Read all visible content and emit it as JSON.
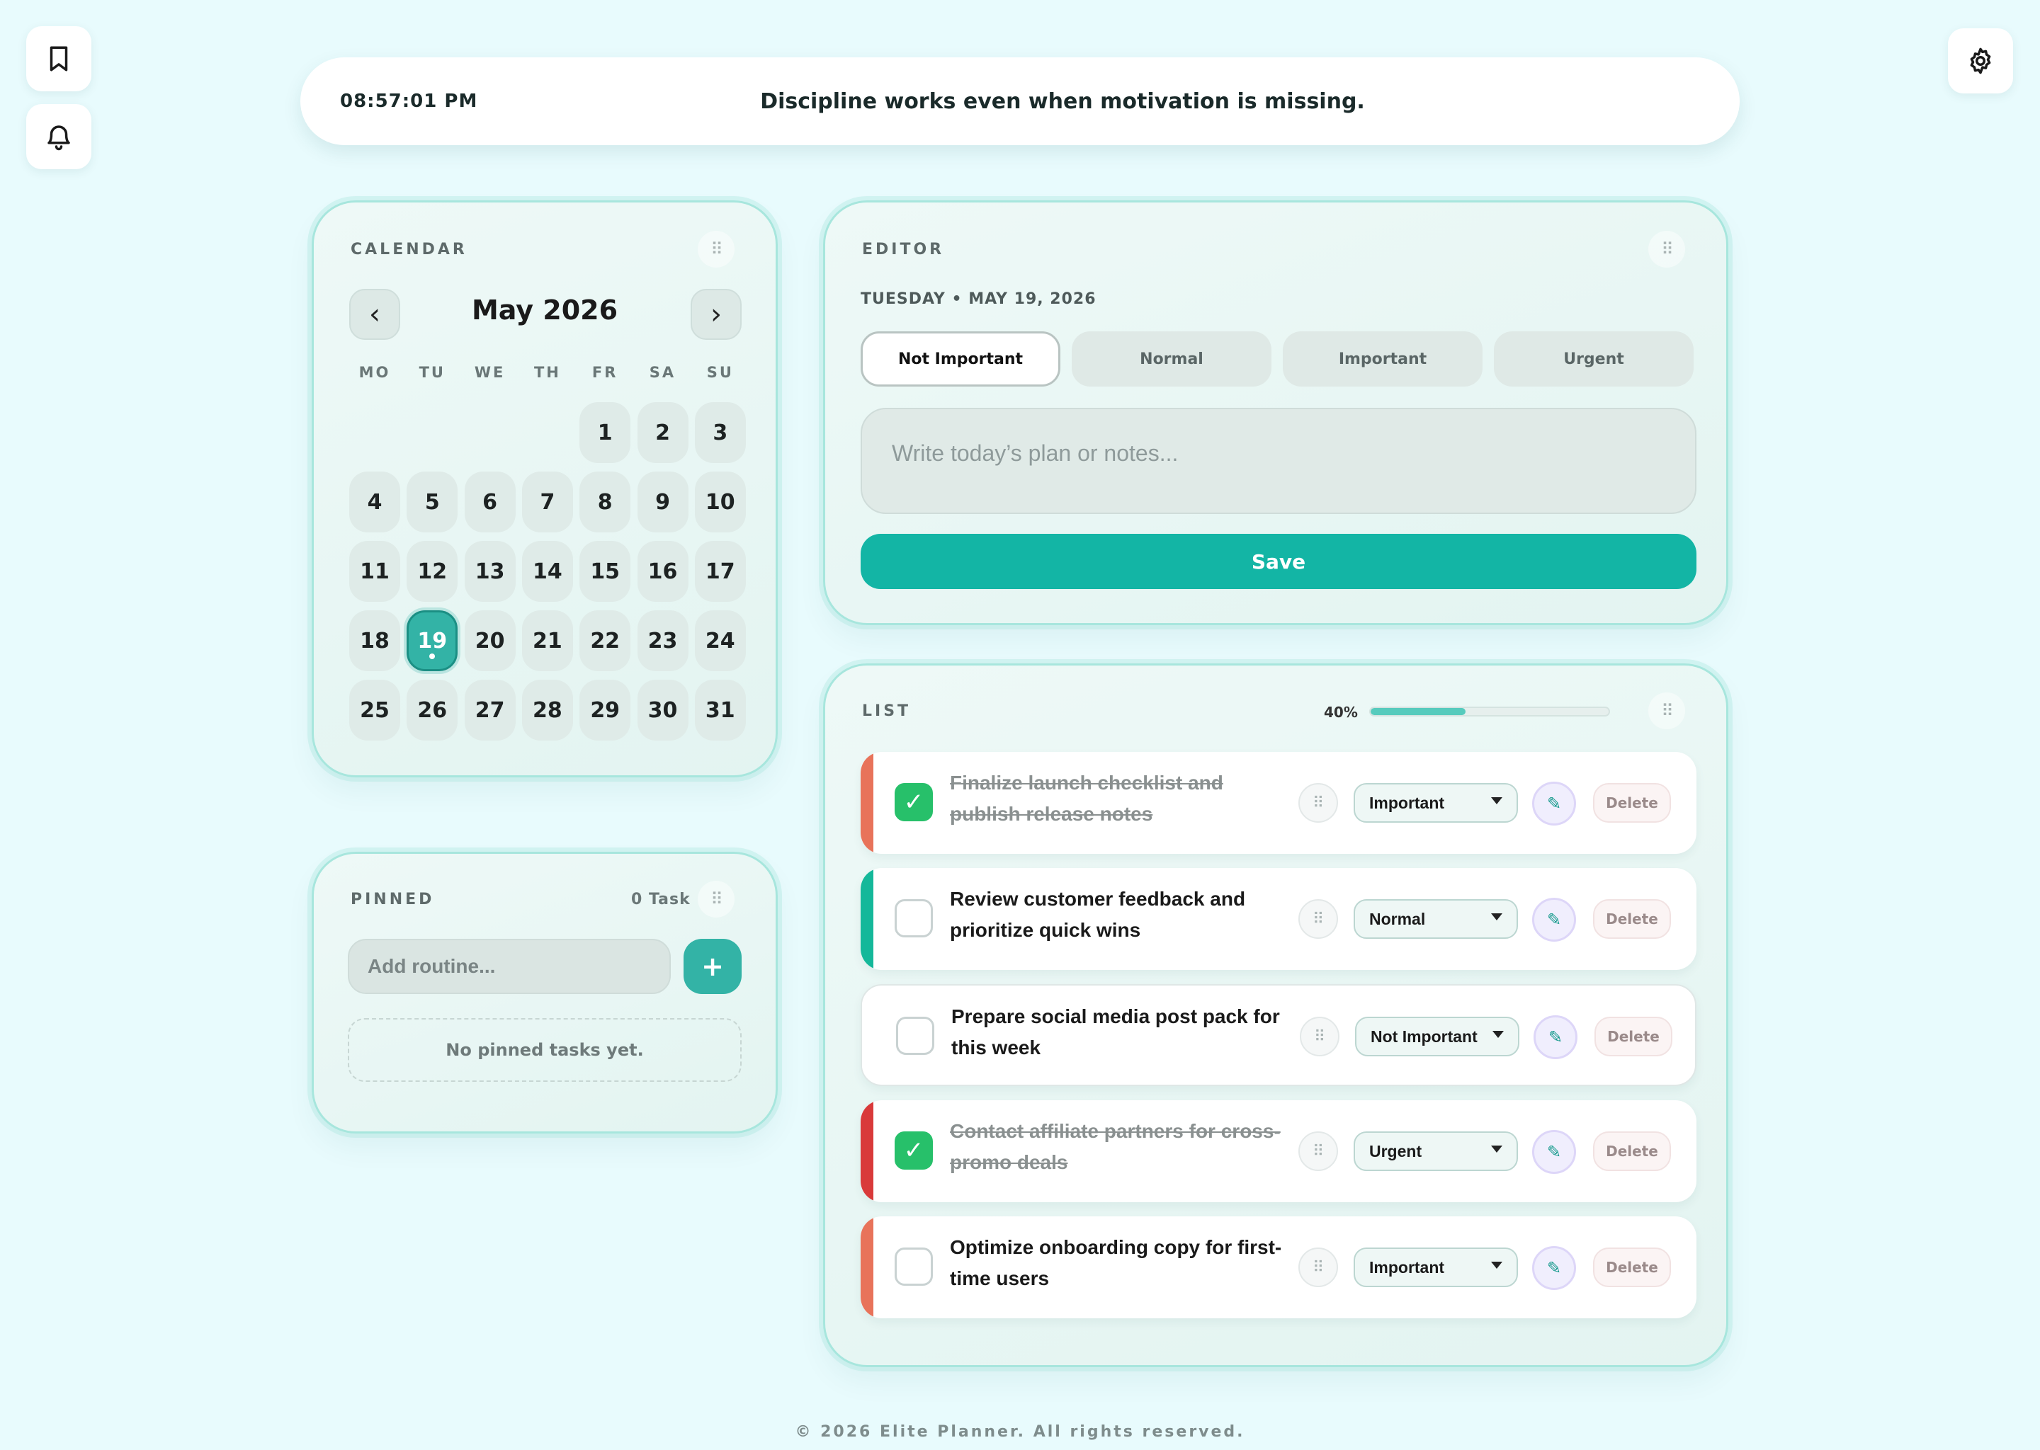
{
  "app": {
    "name": "Elite Planner"
  },
  "header": {
    "clock": "08:57:01 PM",
    "quote": "Discipline works even when motivation is missing."
  },
  "icons": {
    "bookmark": "bookmark-icon",
    "bell": "bell-icon",
    "settings": "gear-icon"
  },
  "calendar": {
    "title": "CALENDAR",
    "month_label": "May 2026",
    "prev": "‹",
    "next": "›",
    "weekdays": [
      "MO",
      "TU",
      "WE",
      "TH",
      "FR",
      "SA",
      "SU"
    ],
    "first_weekday_index": 4,
    "days_in_month": 31,
    "selected_day": 19
  },
  "pinned": {
    "title": "PINNED",
    "count": "0 Task",
    "input_placeholder": "Add routine...",
    "add_label": "+",
    "empty_text": "No pinned tasks yet."
  },
  "editor": {
    "title": "EDITOR",
    "date": "TUESDAY • MAY 19, 2026",
    "priorities": [
      "Not Important",
      "Normal",
      "Important",
      "Urgent"
    ],
    "active_priority": "Not Important",
    "notes_placeholder": "Write today’s plan or notes...",
    "save_label": "Save"
  },
  "list": {
    "title": "LIST",
    "progress_label": "40%",
    "progress": 0.4,
    "delete_label": "Delete",
    "tasks": [
      {
        "text": "Finalize launch checklist and publish release notes",
        "done": true,
        "priority": "Important",
        "color": "#e8735a"
      },
      {
        "text": "Review customer feedback and prioritize quick wins",
        "done": false,
        "priority": "Normal",
        "color": "#14b89a"
      },
      {
        "text": "Prepare social media post pack for this week",
        "done": false,
        "priority": "Not Important",
        "color": "#ffffff"
      },
      {
        "text": "Contact affiliate partners for cross-promo deals",
        "done": true,
        "priority": "Urgent",
        "color": "#d93a3a"
      },
      {
        "text": "Optimize onboarding copy for first-time users",
        "done": false,
        "priority": "Important",
        "color": "#e8735a"
      }
    ]
  },
  "footer": {
    "text": "© 2026 Elite Planner. All rights reserved."
  },
  "colors": {
    "accent": "#13b5a5",
    "background": "#e8fbfd",
    "done_check": "#27c06a"
  }
}
